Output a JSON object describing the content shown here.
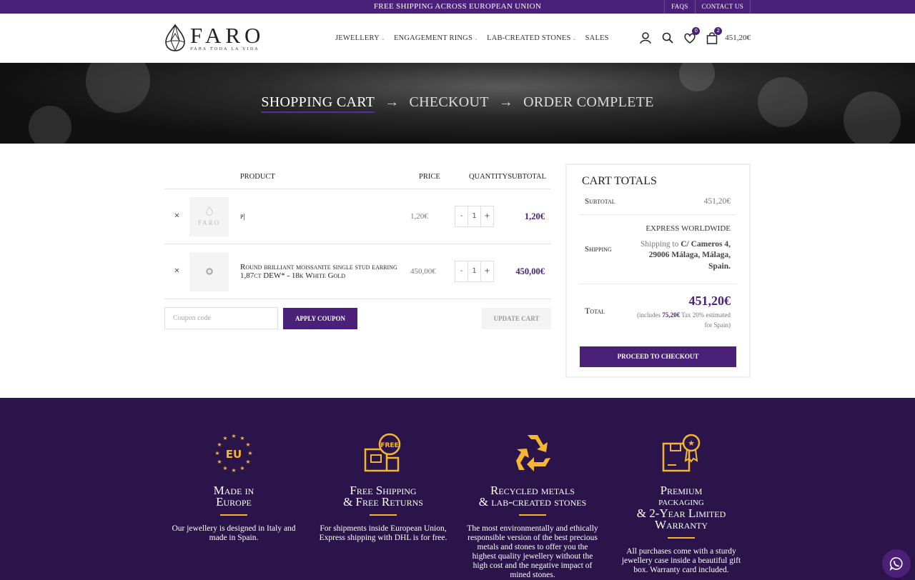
{
  "topbar": {
    "message": "FREE SHIPPING ACROSS EUROPEAN UNION",
    "faqs": "FAQS",
    "contact": "CONTACT US"
  },
  "logo": {
    "name": "FARO",
    "tagline": "PARA TODA LA VIDA"
  },
  "nav": [
    {
      "label": "JEWELLERY",
      "dropdown": true
    },
    {
      "label": "ENGAGEMENT RINGS",
      "dropdown": true
    },
    {
      "label": "LAB-CREATED STONES",
      "dropdown": true
    },
    {
      "label": "SALES",
      "dropdown": false
    }
  ],
  "header_icons": {
    "wishlist_count": "0",
    "cart_count": "2",
    "cart_total": "451,20€",
    "icons": [
      "user-icon",
      "search-icon",
      "heart-icon",
      "bag-icon"
    ]
  },
  "steps": {
    "cart": "SHOPPING CART",
    "checkout": "CHECKOUT",
    "complete": "ORDER COMPLETE",
    "arrow": "→"
  },
  "cart": {
    "headers": {
      "product": "PRODUCT",
      "price": "PRICE",
      "quantity": "QUANTITY",
      "subtotal": "SUBTOTAL"
    },
    "items": [
      {
        "name": "p|",
        "price": "1,20€",
        "qty": "1",
        "subtotal": "1,20€",
        "remove": "×",
        "minus": "-",
        "plus": "+",
        "thumb_text": "FARO"
      },
      {
        "name": "Round brilliant moissanite single stud earring 1,87ct DEW* - 18k White Gold",
        "price": "450,00€",
        "qty": "1",
        "subtotal": "450,00€",
        "remove": "×",
        "minus": "-",
        "plus": "+"
      }
    ],
    "coupon_placeholder": "Coupon code",
    "apply_label": "APPLY COUPON",
    "update_label": "UPDATE CART"
  },
  "totals": {
    "title": "CART TOTALS",
    "subtotal_label": "Subtotal",
    "subtotal_value": "451,20€",
    "shipping_label": "Shipping",
    "shipping_method": "EXPRESS WORLDWIDE",
    "shipping_to_prefix": "Shipping to ",
    "shipping_address_1": "C/ Cameros 4,",
    "shipping_address_2": "29006 Málaga, Málaga,",
    "shipping_address_3": "Spain.",
    "total_label": "Total",
    "total_value": "451,20€",
    "tax_prefix": "(includes ",
    "tax_value": "75,20€",
    "tax_suffix": " Tax 20% estimated",
    "tax_suffix_2": "for Spain)",
    "checkout_label": "PROCEED TO CHECKOUT"
  },
  "features": [
    {
      "icon": "eu-stars-icon",
      "badge": "EU",
      "title_1": "Made in",
      "title_2": "Europe",
      "desc": "Our jewellery is designed in Italy and made in Spain."
    },
    {
      "icon": "free-shipping-box-icon",
      "badge": "FREE",
      "title_1": "Free Shipping",
      "title_2": "& Free Returns",
      "desc": "For shipments inside European Union, Express shipping with DHL is for free."
    },
    {
      "icon": "recycle-icon",
      "title_1": "Recycled metals",
      "title_2": "& lab-created stones",
      "desc": "The most environmentally and ethically responsible version of the best precious metals and stones to offer you the highest quality jewellery without the high cost and the negative impact of mined stones."
    },
    {
      "icon": "premium-box-icon",
      "title_1": "Premium",
      "title_2": "packaging",
      "title_3": "& 2-Year Limited",
      "title_4": "Warranty",
      "desc": "All purchases come with a sturdy jewellery case inside a beautiful gift box. Warranty card included."
    }
  ],
  "colors": {
    "brand": "#4a2079",
    "footer": "#2a1449",
    "accent": "#f5b731"
  }
}
